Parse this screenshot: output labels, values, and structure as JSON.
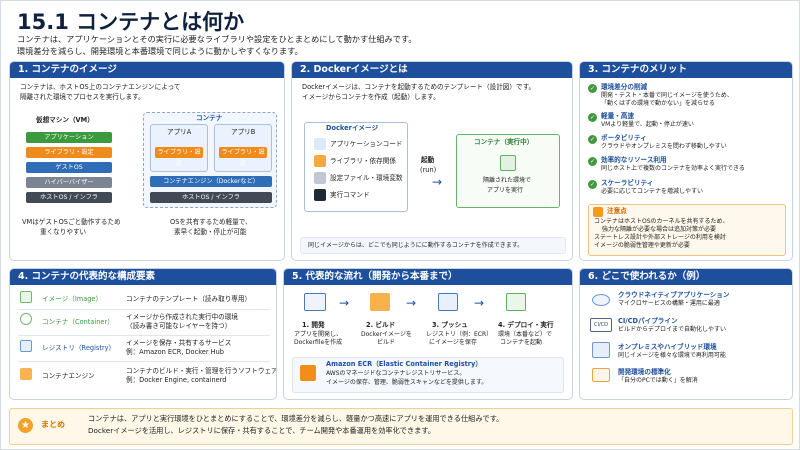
{
  "title": "15.1 コンテナとは何か",
  "subtitle": [
    "コンテナは、アプリケーションとその実行に必要なライブラリや設定をひとまとめにして動かす仕組みです。",
    "環境差分を減らし、開発環境と本番環境で同じように動かしやすくなります。"
  ],
  "s1": {
    "h": "1. コンテナのイメージ",
    "desc": [
      "コンテナは、ホストOS上のコンテナエンジンによって",
      "隔離された環境でプロセスを実行します。"
    ],
    "vm_title": "仮想マシン（VM）",
    "vm_app": "アプリケーション",
    "vm_lib": "ライブラリ・設定",
    "vm_guest": "ゲストOS",
    "vm_hyper": "ハイパーバイザー",
    "vm_host": "ホストOS / インフラ",
    "c_title": "コンテナ",
    "appa": "アプリA",
    "appb": "アプリB",
    "liba": "ライブラリ・設定",
    "libb": "ライブラリ・設定",
    "engine": "コンテナエンジン（Dockerなど）",
    "host2": "ホストOS / インフラ",
    "vm_note": [
      "VMはゲストOSごと動作するため",
      "重くなりやすい"
    ],
    "c_note": [
      "OSを共有するため軽量で、",
      "素早く起動・停止が可能"
    ]
  },
  "s2": {
    "h": "2. Dockerイメージとは",
    "desc": [
      "Dockerイメージは、コンテナを起動するためのテンプレート（設計図）です。",
      "イメージからコンテナを作成（起動）します。"
    ],
    "img_title": "Dockerイメージ",
    "items": [
      "アプリケーションコード",
      "ライブラリ・依存関係",
      "設定ファイル・環境変数",
      "実行コマンド"
    ],
    "start": "起動",
    "run": "(run)",
    "cont_title": "コンテナ（実行中）",
    "cont_desc": [
      "隔離された環境で",
      "アプリを実行"
    ],
    "note": "同じイメージからは、どこでも同じようにに動作するコンテナを作成できます。"
  },
  "s3": {
    "h": "3. コンテナのメリット",
    "items": [
      {
        "t": "環境差分の削減",
        "d": [
          "開発・テスト・本番で同じイメージを使うため、",
          "「動くはずの環境で動かない」を減らせる"
        ]
      },
      {
        "t": "軽量・高速",
        "d": [
          "VMより軽量で、起動・停止が速い"
        ]
      },
      {
        "t": "ポータビリティ",
        "d": [
          "クラウドやオンプレミスを問わず移動しやすい"
        ]
      },
      {
        "t": "効率的なリソース利用",
        "d": [
          "同じホスト上で複数のコンテナを効率よく実行できる"
        ]
      },
      {
        "t": "スケーラビリティ",
        "d": [
          "必要に応じてコンテナを増減しやすい"
        ]
      }
    ],
    "caution": "注意点",
    "cautions": [
      "コンテナはホストOSのカーネルを共有するため、",
      "強力な隔離が必要な場合は追加対策が必要",
      "ステートレス設計や外部ストレージの利用を検討",
      "イメージの脆弱性管理や更新が必要"
    ]
  },
  "s4": {
    "h": "4. コンテナの代表的な構成要素",
    "rows": [
      {
        "n": "イメージ（Image）",
        "d": [
          "コンテナのテンプレート（読み取り専用）"
        ]
      },
      {
        "n": "コンテナ（Container）",
        "d": [
          "イメージから作成された実行中の環境",
          "（読み書き可能なレイヤーを持つ）"
        ]
      },
      {
        "n": "レジストリ（Registry）",
        "d": [
          "イメージを保存・共有するサービス",
          "例：Amazon ECR, Docker Hub"
        ]
      },
      {
        "n": "コンテナエンジン",
        "d": [
          "コンテナのビルド・実行・管理を行うソフトウェア",
          "例：Docker Engine, containerd"
        ]
      }
    ]
  },
  "s5": {
    "h": "5. 代表的な流れ（開発から本番まで）",
    "steps": [
      {
        "t": "1. 開発",
        "d": [
          "アプリを開発し、",
          "Dockerfileを作成"
        ]
      },
      {
        "t": "2. ビルド",
        "d": [
          "Dockerイメージを",
          "ビルド"
        ]
      },
      {
        "t": "3. プッシュ",
        "d": [
          "レジストリ（例：ECR）",
          "にイメージを保存"
        ]
      },
      {
        "t": "4. デプロイ・実行",
        "d": [
          "環境（本番など）で",
          "コンテナを起動"
        ]
      }
    ],
    "ecr_t": "Amazon ECR（Elastic Container Registry）",
    "ecr_d": [
      "AWSのマネージドなコンテナレジストリサービス。",
      "イメージの保存、管理、脆弱性スキャンなどを提供します。"
    ]
  },
  "s6": {
    "h": "6. どこで使われるか（例）",
    "items": [
      {
        "t": "クラウドネイティブアプリケーション",
        "d": "マイクロサービスの構築・運用に最適"
      },
      {
        "t": "CI/CDパイプライン",
        "d": "ビルドからデプロイまで自動化しやすい"
      },
      {
        "t": "オンプレミスやハイブリッド環境",
        "d": "同じイメージを様々な環境で再利用可能"
      },
      {
        "t": "開発環境の標準化",
        "d": "「自分のPCでは動く」を解消"
      }
    ],
    "cicd": "CI/CD"
  },
  "summary": {
    "h": "まとめ",
    "l1": "コンテナは、アプリと実行環境をひとまとめにすることで、環境差分を減らし、軽量かつ高速にアプリを運用できる仕組みです。",
    "l2": "Dockerイメージを活用し、レジストリに保存・共有することで、チーム開発や本番運用を効率化できます。"
  }
}
